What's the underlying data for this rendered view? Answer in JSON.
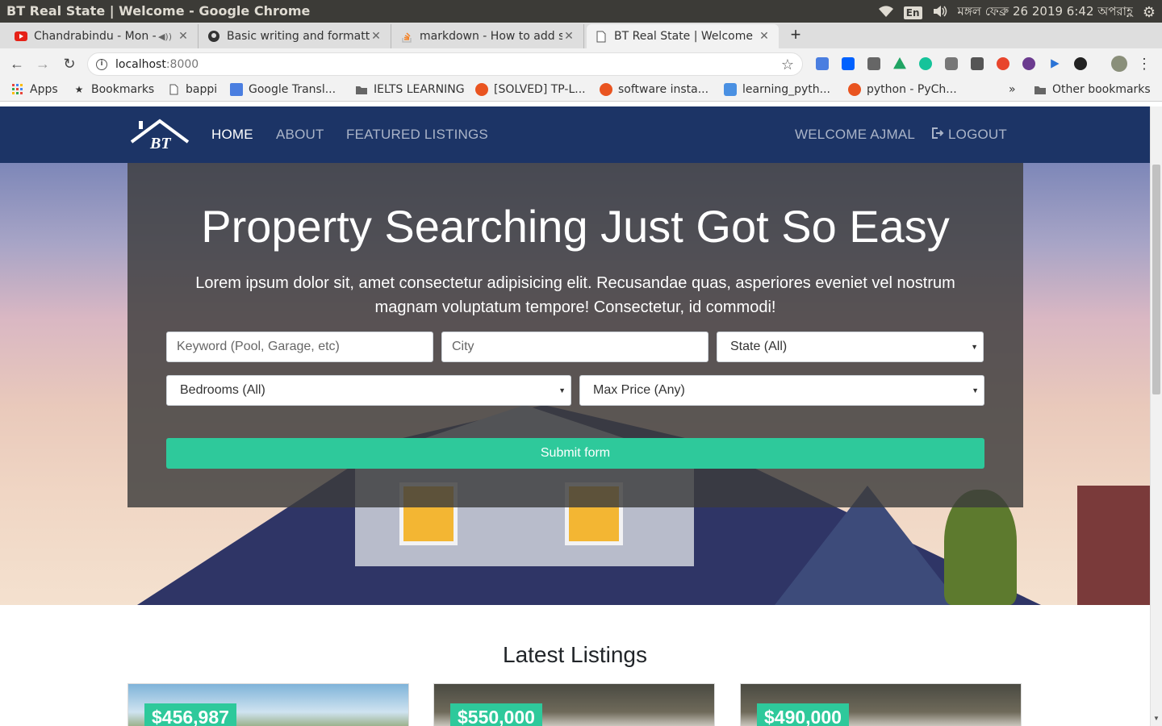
{
  "os": {
    "window_title": "BT Real State | Welcome - Google Chrome",
    "keyboard": "En",
    "clock": "মঙ্গল ফেব্রু 26 2019 6:42 অপরাহ্ণ"
  },
  "tabs": [
    {
      "title": "Chandrabindu - Mon - |",
      "icon": "youtube-icon"
    },
    {
      "title": "Basic writing and formatt",
      "icon": "github-icon"
    },
    {
      "title": "markdown - How to add s",
      "icon": "stackoverflow-icon"
    },
    {
      "title": "BT Real State | Welcome",
      "icon": "page-icon"
    }
  ],
  "address": {
    "host": "localhost",
    "port": ":8000"
  },
  "bookmarks": [
    {
      "label": "Apps",
      "icon": "apps-grid-icon"
    },
    {
      "label": "Bookmarks",
      "icon": "star-icon"
    },
    {
      "label": "bappi",
      "icon": "page-icon"
    },
    {
      "label": "Google Transl...",
      "icon": "google-translate-icon"
    },
    {
      "label": "IELTS LEARNING",
      "icon": "folder-icon"
    },
    {
      "label": "[SOLVED] TP-L...",
      "icon": "ubuntu-icon"
    },
    {
      "label": "software insta...",
      "icon": "askubuntu-icon"
    },
    {
      "label": "learning_pyth...",
      "icon": "colab-icon"
    },
    {
      "label": "python - PyCh...",
      "icon": "askubuntu-icon"
    },
    {
      "label": "»",
      "icon": ""
    },
    {
      "label": "Other bookmarks",
      "icon": "folder-icon"
    }
  ],
  "nav": {
    "home": "HOME",
    "about": "ABOUT",
    "featured": "FEATURED LISTINGS",
    "welcome": "WELCOME AJMAL",
    "logout": "LOGOUT"
  },
  "hero": {
    "title": "Property Searching Just Got So Easy",
    "subtitle": "Lorem ipsum dolor sit, amet consectetur adipisicing elit. Recusandae quas, asperiores eveniet vel nostrum magnam voluptatum tempore! Consectetur, id commodi!"
  },
  "form": {
    "keyword_placeholder": "Keyword (Pool, Garage, etc)",
    "city_placeholder": "City",
    "state_selected": "State (All)",
    "bedrooms_selected": "Bedrooms (All)",
    "max_price_selected": "Max Price (Any)",
    "submit": "Submit form"
  },
  "latest": {
    "heading": "Latest Listings",
    "prices": [
      "$456,987",
      "$550,000",
      "$490,000"
    ]
  },
  "colors": {
    "navbar": "#1c3466",
    "accent": "#2ec99b",
    "overlay": "#3c3c3c"
  }
}
